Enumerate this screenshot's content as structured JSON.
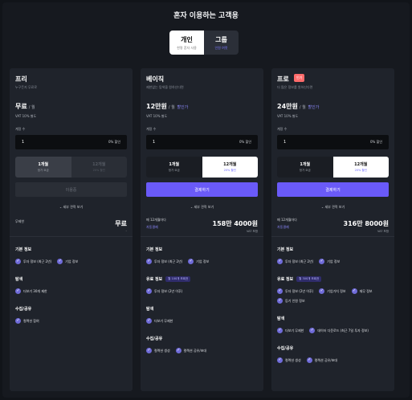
{
  "page": {
    "title": "혼자 이용하는 고객용"
  },
  "segment": {
    "options": [
      {
        "label": "개인",
        "sub": "한명 혼자 사용"
      },
      {
        "label": "그룹",
        "sub": "인원 여럿"
      }
    ]
  },
  "plans": [
    {
      "name": "프리",
      "desc": "누구든지 무료로",
      "price": "무료",
      "per": "/ 월",
      "discount": "",
      "vat": "VAT 10% 별도",
      "count_label": "계정 수",
      "count_value": "1",
      "count_discount": "0% 할인",
      "period_options": [
        {
          "label": "1개월",
          "sub": "정가 요금"
        },
        {
          "label": "12개월",
          "sub": "20% 할인"
        }
      ],
      "cta": "이용중",
      "details": "⌄ 세부 견적 보기",
      "summary_label": "무제한",
      "summary_value": "무료",
      "summary_dash": "-",
      "sections": [
        {
          "title": "기본 정보",
          "tag": "",
          "items": [
            "투자 정보 (최근 2년)",
            "기업 정보"
          ]
        },
        {
          "title": "탐색",
          "tag": "",
          "items": [
            "더보기 30개 제한"
          ]
        },
        {
          "title": "수집/공유",
          "tag": "",
          "items": [
            "컬렉션 참여"
          ]
        }
      ]
    },
    {
      "name": "베이직",
      "desc": "제한없는 탐색을 원하신다면",
      "price": "12만원",
      "per": "/ 월",
      "discount": "할인가",
      "vat": "VAT 10% 별도",
      "count_label": "계정 수",
      "count_value": "1",
      "count_discount": "0% 할인",
      "period_options": [
        {
          "label": "1개월",
          "sub": "정가 요금"
        },
        {
          "label": "12개월",
          "sub": "20% 할인"
        }
      ],
      "cta": "결제하기",
      "details": "⌄ 세부 견적 보기",
      "summary_label": "매 12개월마다",
      "summary_sub": "자동결제",
      "summary_value": "158만 4000원",
      "summary_vat": "VAT 포함",
      "sections": [
        {
          "title": "기본 정보",
          "tag": "",
          "items": [
            "투자 정보 (최근 2년)",
            "기업 정보"
          ]
        },
        {
          "title": "유료 정보",
          "tag": "월 100개 조회권",
          "items": [
            "투자 정보 (2년 이후)"
          ]
        },
        {
          "title": "탐색",
          "tag": "",
          "items": [
            "더보기 무제한"
          ]
        },
        {
          "title": "수집/공유",
          "tag": "",
          "items": [
            "컬렉션 생성",
            "컬렉션 공유/초대"
          ]
        }
      ]
    },
    {
      "name": "프로",
      "badge": "인기",
      "desc": "더 많은 정보를 원하신다면",
      "price": "24만원",
      "per": "/ 월",
      "discount": "할인가",
      "vat": "VAT 10% 별도",
      "count_label": "계정 수",
      "count_value": "1",
      "count_discount": "0% 할인",
      "period_options": [
        {
          "label": "1개월",
          "sub": "정가 요금"
        },
        {
          "label": "12개월",
          "sub": "20% 할인"
        }
      ],
      "cta": "결제하기",
      "details": "⌄ 세부 견적 보기",
      "summary_label": "매 12개월마다",
      "summary_sub": "자동결제",
      "summary_value": "316만 8000원",
      "summary_vat": "VAT 포함",
      "sections": [
        {
          "title": "기본 정보",
          "tag": "",
          "items": [
            "투자 정보 (최근 2년)",
            "기업 정보"
          ]
        },
        {
          "title": "유료 정보",
          "tag": "월 300개 조회권",
          "items": [
            "투자 정보 (2년 이후)",
            "기업가치 정보",
            "재무 정보",
            "등기 인원 정보"
          ]
        },
        {
          "title": "탐색",
          "tag": "",
          "items": [
            "더보기 무제한",
            "데이터 다운로드 (최근 7일 투자 정보)"
          ]
        },
        {
          "title": "수집/공유",
          "tag": "",
          "items": [
            "컬렉션 생성",
            "컬렉션 공유/초대"
          ]
        }
      ]
    }
  ],
  "colors": {
    "accent": "#6a5af9",
    "accent_text": "#8d8aff",
    "badge": "#ff6b6b"
  }
}
